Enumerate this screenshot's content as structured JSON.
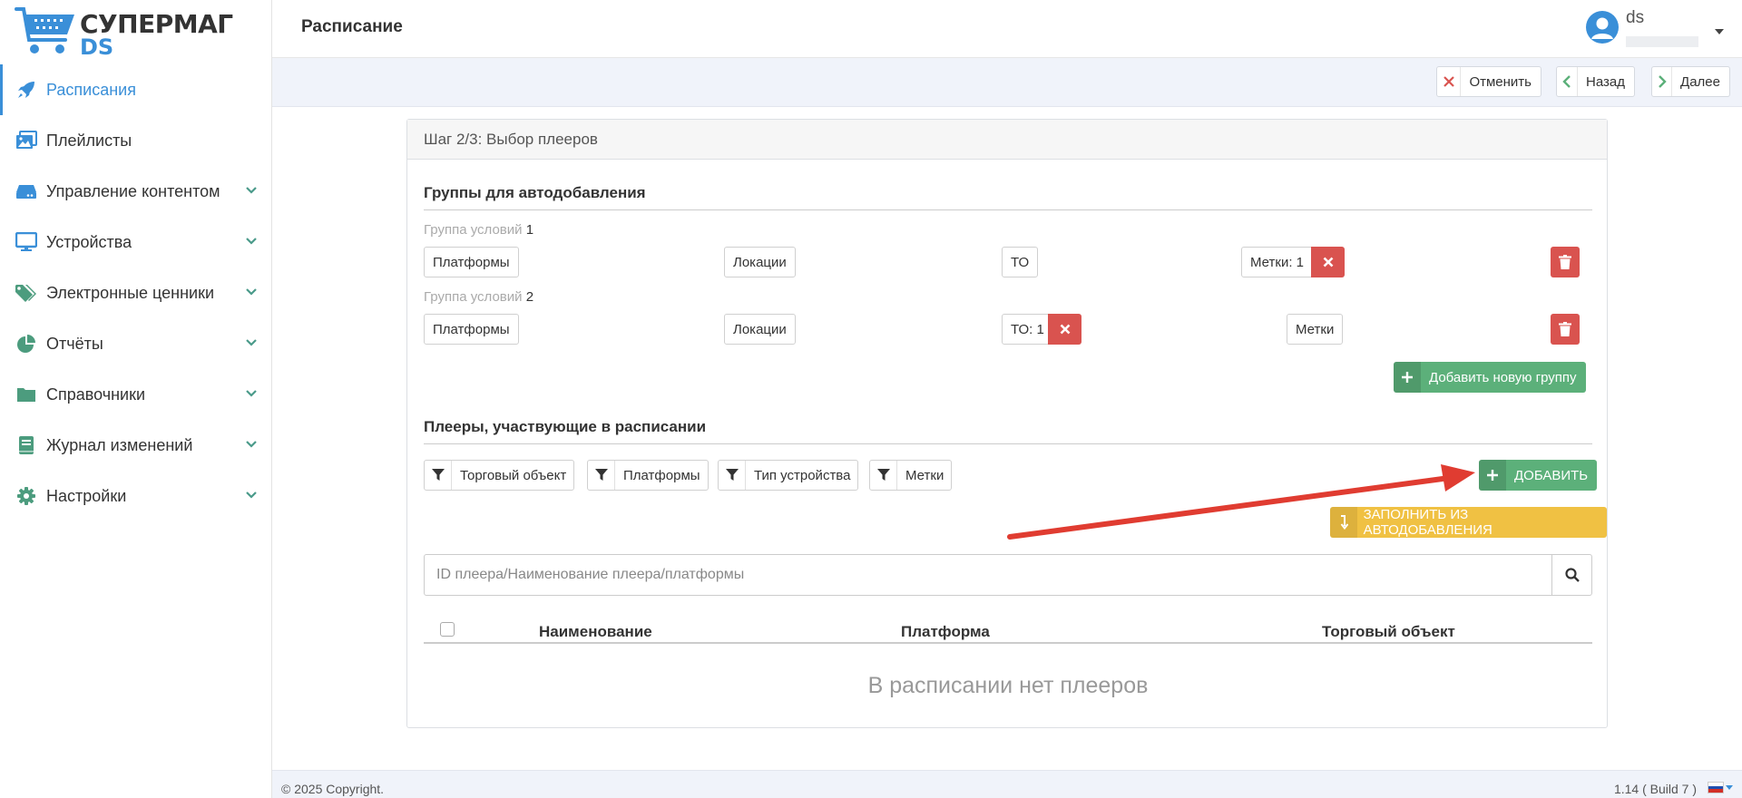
{
  "app": {
    "logo_line1": "СУПЕРМАГ",
    "logo_line2": "DS"
  },
  "sidebar": {
    "items": [
      {
        "label": "Расписания",
        "icon": "rocket-icon",
        "active": true
      },
      {
        "label": "Плейлисты",
        "icon": "images-icon"
      },
      {
        "label": "Управление контентом",
        "icon": "hdd-icon",
        "expandable": true
      },
      {
        "label": "Устройства",
        "icon": "monitor-icon",
        "expandable": true
      },
      {
        "label": "Электронные ценники",
        "icon": "tags-icon",
        "expandable": true
      },
      {
        "label": "Отчёты",
        "icon": "pie-chart-icon",
        "expandable": true
      },
      {
        "label": "Справочники",
        "icon": "folder-icon",
        "expandable": true
      },
      {
        "label": "Журнал изменений",
        "icon": "book-icon",
        "expandable": true
      },
      {
        "label": "Настройки",
        "icon": "gear-icon",
        "expandable": true
      }
    ]
  },
  "header": {
    "title": "Расписание",
    "username": "ds"
  },
  "toolbar": {
    "cancel_label": "Отменить",
    "back_label": "Назад",
    "next_label": "Далее"
  },
  "wizard": {
    "step_title": "Шаг 2/3: Выбор плееров",
    "auto_groups": {
      "title": "Группы для автодобавления",
      "group_label": "Группа условий",
      "groups": [
        {
          "number": "1",
          "platforms": "Платформы",
          "locations": "Локации",
          "to": "ТО",
          "tags": "Метки: 1"
        },
        {
          "number": "2",
          "platforms": "Платформы",
          "locations": "Локации",
          "to": "ТО: 1",
          "tags": "Метки"
        }
      ],
      "add_group_label": "Добавить новую группу"
    },
    "players": {
      "title": "Плееры, участвующие в расписании",
      "filters": [
        "Торговый объект",
        "Платформы",
        "Тип устройства",
        "Метки"
      ],
      "add_label": "ДОБАВИТЬ",
      "fill_label": "ЗАПОЛНИТЬ ИЗ АВТОДОБАВЛЕНИЯ",
      "search_placeholder": "ID плеера/Наименование плеера/платформы",
      "columns": [
        "Наименование",
        "Платформа",
        "Торговый объект"
      ],
      "empty_text": "В расписании нет плееров"
    }
  },
  "footer": {
    "copyright": "© 2025 Copyright.",
    "version": "1.14 ( Build 7 )",
    "language_flag": "russia-flag-icon"
  },
  "colors": {
    "accent": "#3a8fd8",
    "success": "#5cb07a",
    "danger": "#d9534f",
    "warning": "#f0c143",
    "annotation_arrow": "#e03c31",
    "sidebar_icon": "#4c9c7e"
  }
}
